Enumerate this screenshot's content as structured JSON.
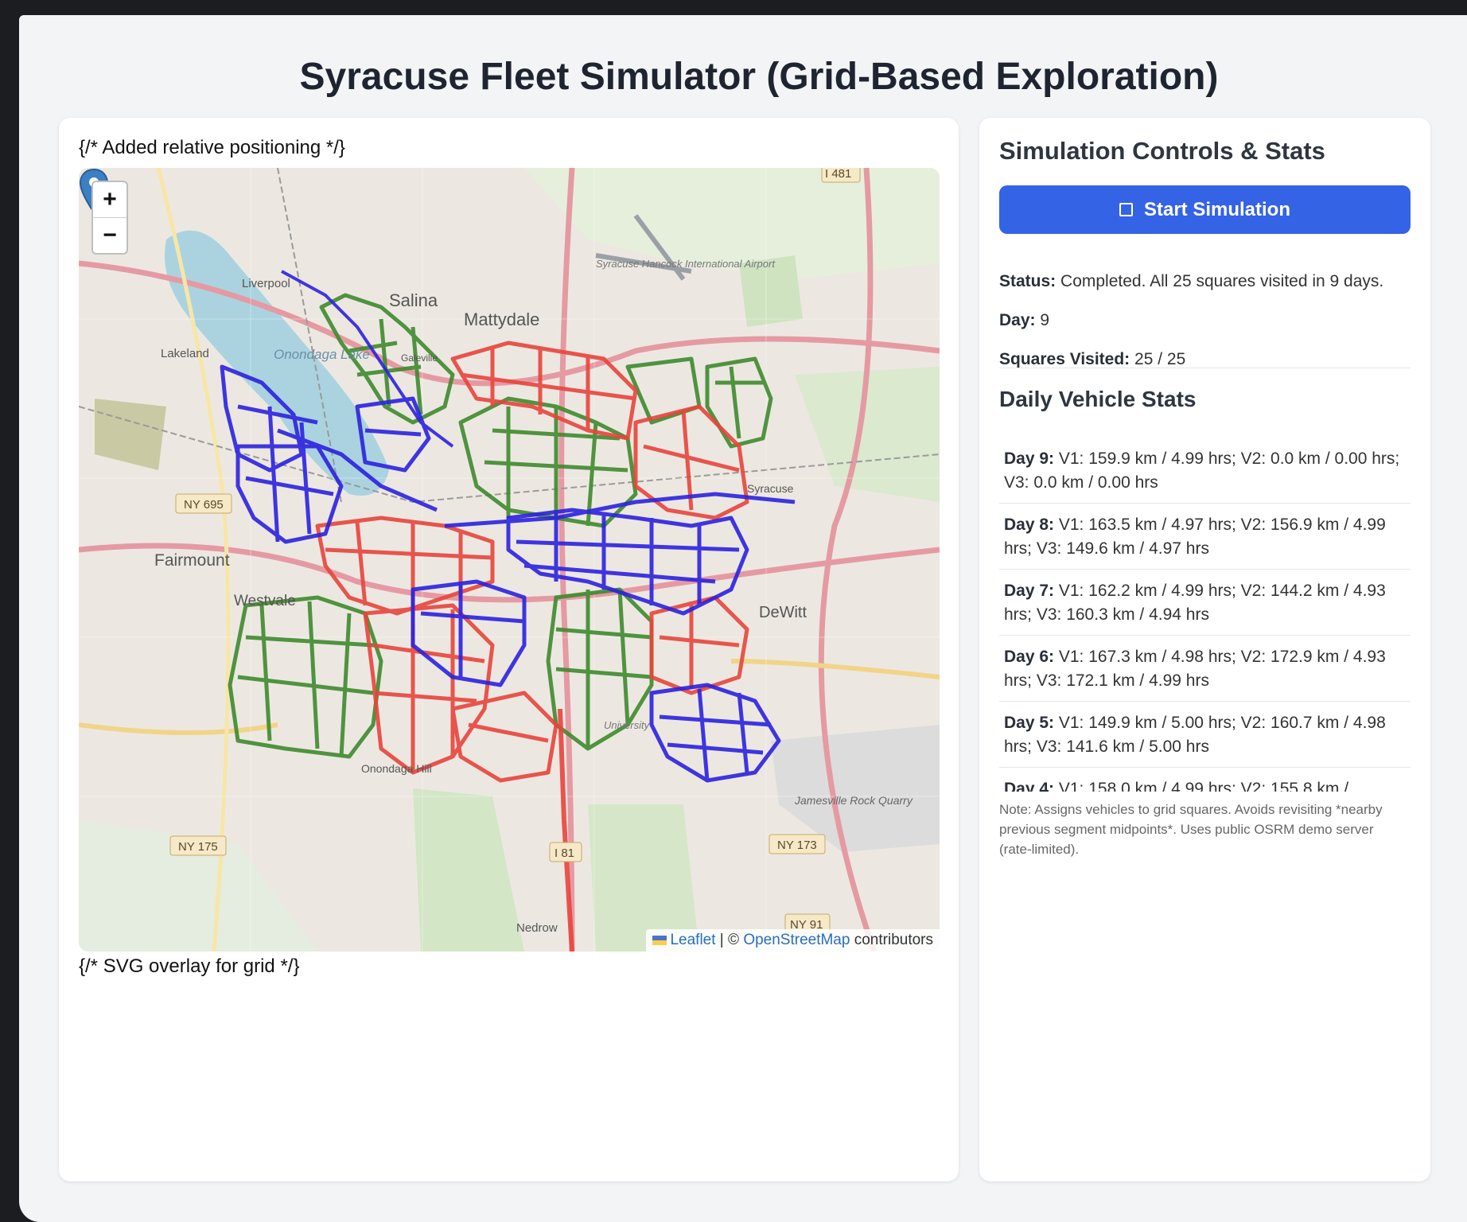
{
  "page": {
    "title": "Syracuse Fleet Simulator (Grid-Based Exploration)"
  },
  "map_panel": {
    "comment_top": "{/* Added relative positioning */}",
    "comment_bottom": "{/* SVG overlay for grid */}",
    "zoom_in": "+",
    "zoom_out": "−",
    "attribution": {
      "leaflet": "Leaflet",
      "separator": " | © ",
      "osm": "OpenStreetMap",
      "suffix": " contributors"
    },
    "map_labels": {
      "salina": "Salina",
      "mattydale": "Mattydale",
      "liverpool": "Liverpool",
      "lakeland": "Lakeland",
      "onondaga_lake": "Onondaga Lake",
      "fairmount": "Fairmount",
      "westvale": "Westvale",
      "dewitt": "DeWitt",
      "syracuse": "Syracuse",
      "airport": "Syracuse Hancock International Airport",
      "onondaga_hill": "Onondaga Hill",
      "jamesville": "Jamesville Rock Quarry",
      "nedrow": "Nedrow",
      "university": "University",
      "galeville": "Galeville",
      "ny695": "NY 695",
      "ny175": "NY 175",
      "ny173": "NY 173",
      "ny91": "NY 91",
      "i81": "I 81",
      "i481": "I 481"
    },
    "route_colors": {
      "red": "#e8453c",
      "green": "#3f8a2e",
      "blue": "#2c22e0"
    }
  },
  "controls": {
    "heading": "Simulation Controls & Stats",
    "start_button": "Start Simulation",
    "status_label": "Status:",
    "status_value": "Completed. All 25 squares visited in 9 days.",
    "day_label": "Day:",
    "day_value": "9",
    "squares_label": "Squares Visited:",
    "squares_value": "25 / 25",
    "accent_color": "#3563e5"
  },
  "daily": {
    "heading": "Daily Vehicle Stats",
    "rows": [
      {
        "day": "Day 9:",
        "text": "V1: 159.9 km / 4.99 hrs; V2: 0.0 km / 0.00 hrs; V3: 0.0 km / 0.00 hrs"
      },
      {
        "day": "Day 8:",
        "text": "V1: 163.5 km / 4.97 hrs; V2: 156.9 km / 4.99 hrs; V3: 149.6 km / 4.97 hrs"
      },
      {
        "day": "Day 7:",
        "text": "V1: 162.2 km / 4.99 hrs; V2: 144.2 km / 4.93 hrs; V3: 160.3 km / 4.94 hrs"
      },
      {
        "day": "Day 6:",
        "text": "V1: 167.3 km / 4.98 hrs; V2: 172.9 km / 4.93 hrs; V3: 172.1 km / 4.99 hrs"
      },
      {
        "day": "Day 5:",
        "text": "V1: 149.9 km / 5.00 hrs; V2: 160.7 km / 4.98 hrs; V3: 141.6 km / 5.00 hrs"
      },
      {
        "day": "Day 4:",
        "text": "V1: 158.0 km / 4.99 hrs; V2: 155.8 km /"
      }
    ],
    "note": "Note: Assigns vehicles to grid squares. Avoids revisiting *nearby previous segment midpoints*. Uses public OSRM demo server (rate-limited)."
  }
}
